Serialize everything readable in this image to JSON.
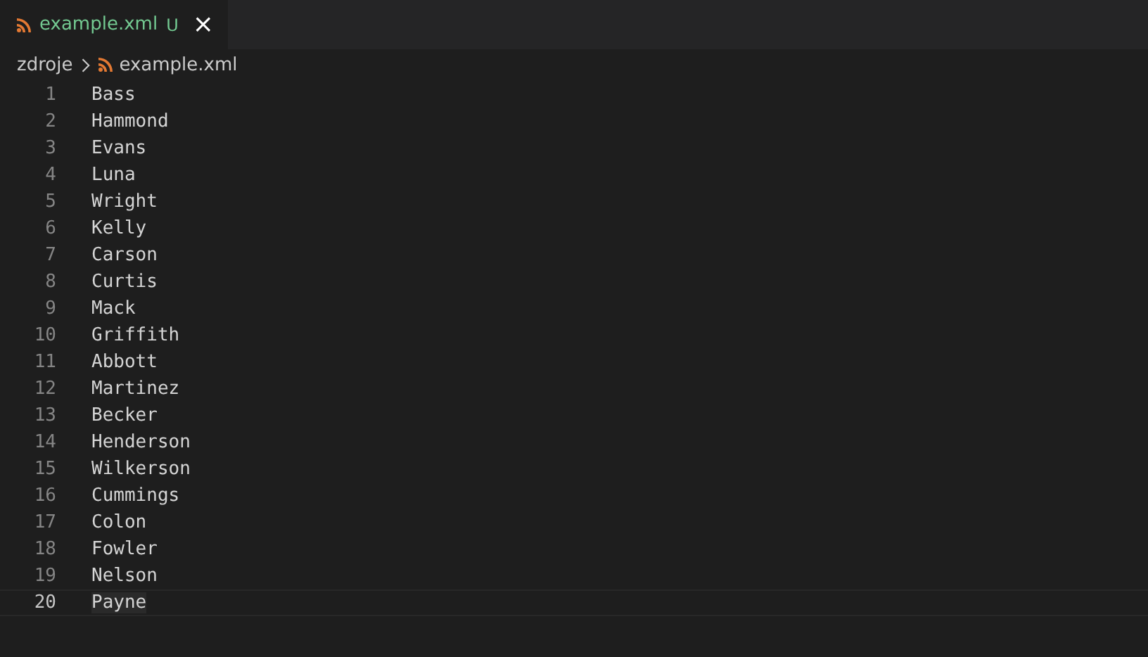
{
  "tabs": [
    {
      "label": "example.xml",
      "status": "U",
      "selected": true,
      "close": "×"
    }
  ],
  "breadcrumb": [
    {
      "label": "zdroje",
      "kind": "folder"
    },
    {
      "label": "example.xml",
      "kind": "file"
    }
  ],
  "lines": [
    {
      "number": "1",
      "text": "Bass",
      "selected": false
    },
    {
      "number": "2",
      "text": "Hammond",
      "selected": false
    },
    {
      "number": "3",
      "text": "Evans",
      "selected": false
    },
    {
      "number": "4",
      "text": "Luna",
      "selected": false
    },
    {
      "number": "5",
      "text": "Wright",
      "selected": false
    },
    {
      "number": "6",
      "text": "Kelly",
      "selected": false
    },
    {
      "number": "7",
      "text": "Carson",
      "selected": false
    },
    {
      "number": "8",
      "text": "Curtis",
      "selected": false
    },
    {
      "number": "9",
      "text": "Mack",
      "selected": false
    },
    {
      "number": "10",
      "text": "Griffith",
      "selected": false
    },
    {
      "number": "11",
      "text": "Abbott",
      "selected": false
    },
    {
      "number": "12",
      "text": "Martinez",
      "selected": false
    },
    {
      "number": "13",
      "text": "Becker",
      "selected": false
    },
    {
      "number": "14",
      "text": "Henderson",
      "selected": false
    },
    {
      "number": "15",
      "text": "Wilkerson",
      "selected": false
    },
    {
      "number": "16",
      "text": "Cummings",
      "selected": false
    },
    {
      "number": "17",
      "text": "Colon",
      "selected": false
    },
    {
      "number": "18",
      "text": "Fowler",
      "selected": false
    },
    {
      "number": "19",
      "text": "Nelson",
      "selected": false
    },
    {
      "number": "20",
      "text": "Payne",
      "selected": true
    }
  ]
}
